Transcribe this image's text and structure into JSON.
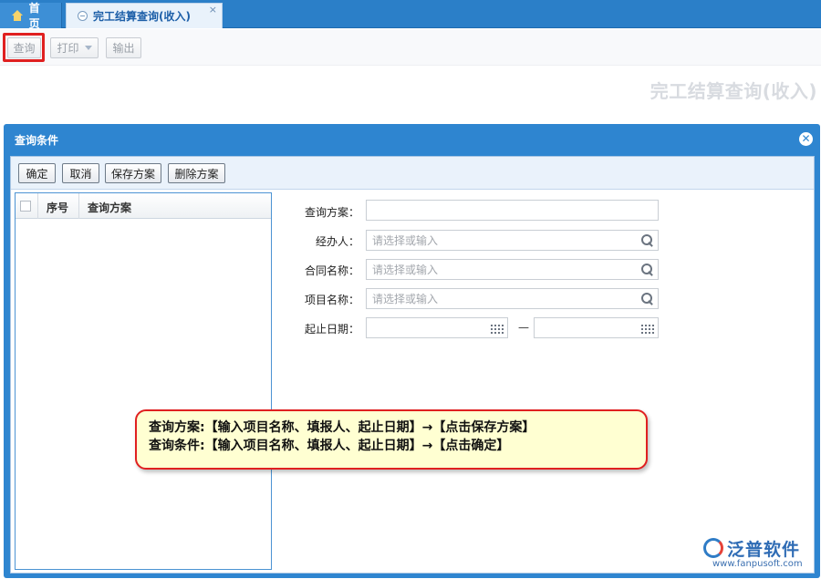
{
  "tabs": {
    "home_label": "首页",
    "active_label": "完工结算查询(收入)",
    "close_glyph": "×"
  },
  "toolbar": {
    "query_label": "查询",
    "print_label": "打印",
    "export_label": "输出"
  },
  "page": {
    "heading": "完工结算查询(收入)"
  },
  "dialog": {
    "title": "查询条件",
    "close_glyph": "✕",
    "buttons": {
      "ok": "确定",
      "cancel": "取消",
      "save_plan": "保存方案",
      "delete_plan": "删除方案"
    },
    "plan_list": {
      "col_no": "序号",
      "col_name": "查询方案"
    },
    "form": {
      "plan_label": "查询方案：",
      "handler_label": "经办人：",
      "contract_label": "合同名称：",
      "project_label": "项目名称：",
      "date_label": "起止日期：",
      "select_placeholder": "请选择或输入",
      "date_separator": "—"
    }
  },
  "callout": {
    "line1": "查询方案:【输入项目名称、填报人、起止日期】→【点击保存方案】",
    "line2": "查询条件:【输入项目名称、填报人、起止日期】→【点击确定】"
  },
  "brand": {
    "name": "泛普软件",
    "url": "www.fanpusoft.com"
  }
}
